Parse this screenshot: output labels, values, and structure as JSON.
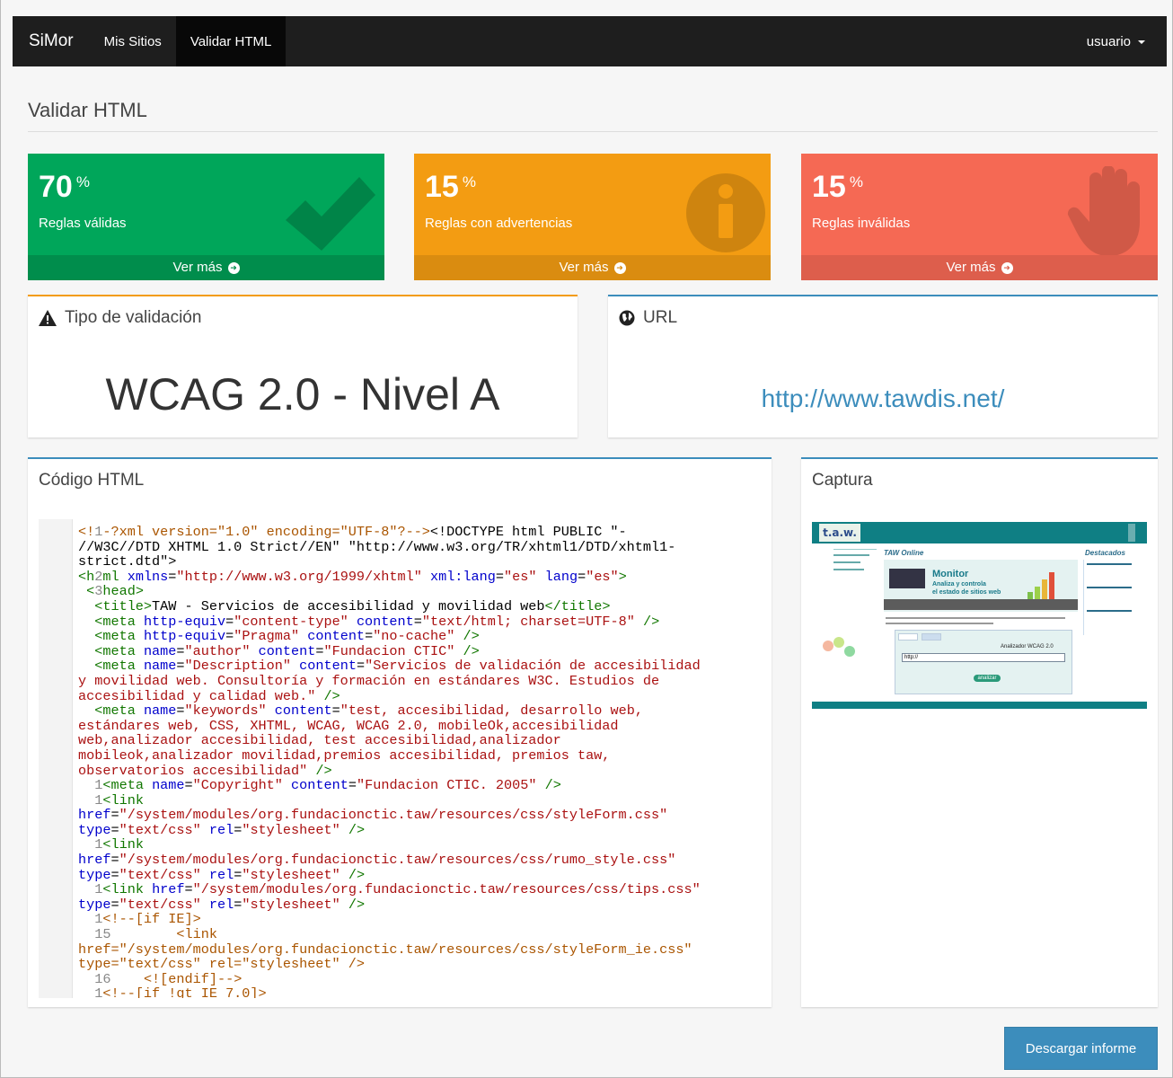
{
  "navbar": {
    "brand": "SiMor",
    "items": [
      {
        "label": "Mis Sitios"
      },
      {
        "label": "Validar HTML"
      }
    ],
    "user": "usuario"
  },
  "page": {
    "title": "Validar HTML"
  },
  "stats": [
    {
      "value": "70",
      "unit": "%",
      "label": "Reglas válidas",
      "more": "Ver más",
      "color": "#00a65a",
      "icon": "check-icon"
    },
    {
      "value": "15",
      "unit": "%",
      "label": "Reglas con advertencias",
      "more": "Ver más",
      "color": "#f39c12",
      "icon": "info-icon"
    },
    {
      "value": "15",
      "unit": "%",
      "label": "Reglas inválidas",
      "more": "Ver más",
      "color": "#f56954",
      "icon": "hand-stop-icon"
    }
  ],
  "validation": {
    "title": "Tipo de validación",
    "value": "WCAG 2.0 - Nivel A",
    "icon": "warning-icon"
  },
  "url": {
    "title": "URL",
    "value": "http://www.tawdis.net/",
    "icon": "globe-icon"
  },
  "code_panel": {
    "title": "Código HTML"
  },
  "capture_panel": {
    "title": "Captura",
    "shot": {
      "logo": "t.a.w.",
      "heading": "TAW Online",
      "side": "Destacados",
      "banner_title": "Monitor",
      "banner_sub1": "Analiza y controla",
      "banner_sub2": "el estado de sitios web",
      "tool": "Analizador WCAG 2.0",
      "input": "http://",
      "button": "analizar"
    }
  },
  "download": {
    "label": "Descargar informe"
  }
}
